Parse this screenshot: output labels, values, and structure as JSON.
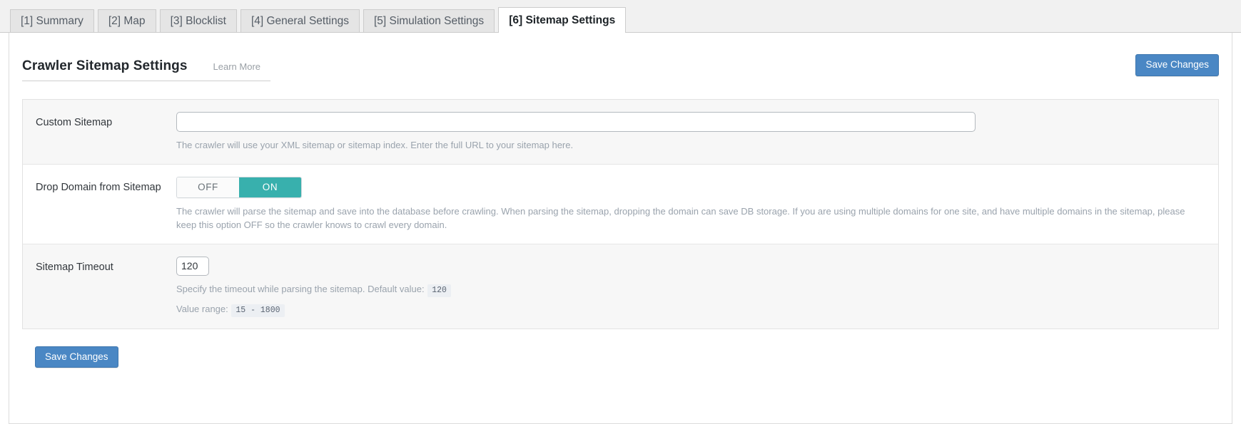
{
  "tabs": [
    {
      "label": "[1] Summary",
      "active": false
    },
    {
      "label": "[2] Map",
      "active": false
    },
    {
      "label": "[3] Blocklist",
      "active": false
    },
    {
      "label": "[4] General Settings",
      "active": false
    },
    {
      "label": "[5] Simulation Settings",
      "active": false
    },
    {
      "label": "[6] Sitemap Settings",
      "active": true
    }
  ],
  "header": {
    "title": "Crawler Sitemap Settings",
    "learn_more": "Learn More",
    "save_label": "Save Changes"
  },
  "settings": {
    "custom_sitemap": {
      "label": "Custom Sitemap",
      "value": "",
      "placeholder": "",
      "help": "The crawler will use your XML sitemap or sitemap index. Enter the full URL to your sitemap here."
    },
    "drop_domain": {
      "label": "Drop Domain from Sitemap",
      "off_label": "OFF",
      "on_label": "ON",
      "selected": "ON",
      "help": "The crawler will parse the sitemap and save into the database before crawling. When parsing the sitemap, dropping the domain can save DB storage. If you are using multiple domains for one site, and have multiple domains in the sitemap, please keep this option OFF so the crawler knows to crawl every domain."
    },
    "sitemap_timeout": {
      "label": "Sitemap Timeout",
      "value": "120",
      "help_prefix": "Specify the timeout while parsing the sitemap. Default value:",
      "default_value": "120",
      "range_label": "Value range:",
      "range_value": "15 - 1800"
    }
  },
  "footer": {
    "save_label": "Save Changes"
  },
  "colors": {
    "accent_blue": "#4a87c4",
    "toggle_on_teal": "#38b0ad",
    "row_alt_bg": "#f7f7f7",
    "tab_bar_bg": "#f1f1f1"
  }
}
